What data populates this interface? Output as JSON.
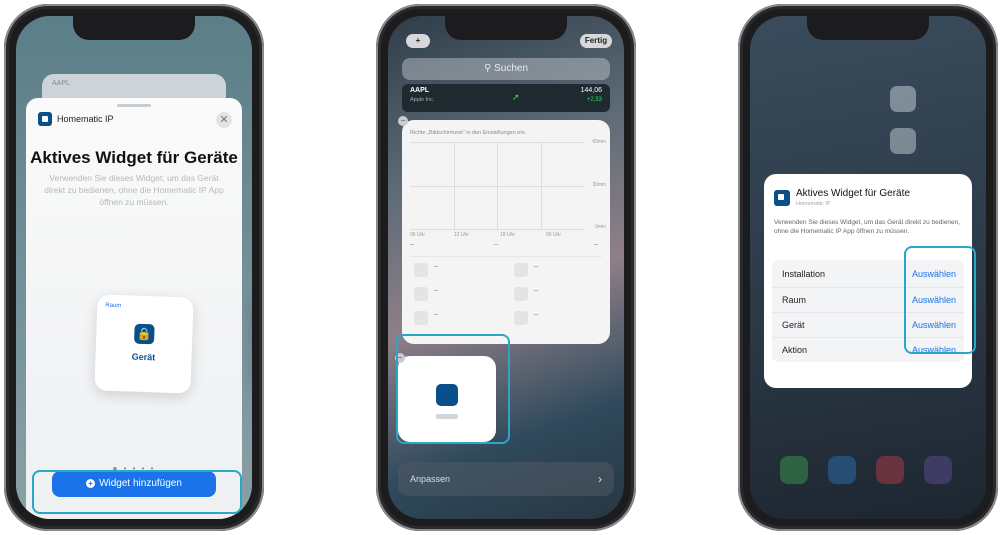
{
  "screen1": {
    "app_name": "Homematic IP",
    "peek_text": "AAPL",
    "close_label": "✕",
    "widget_title": "Aktives Widget für Geräte",
    "widget_description": "Verwenden Sie dieses Widget, um das Gerät direkt zu bedienen, ohne die Homematic IP App öffnen zu müssen.",
    "card_room_label": "Raum",
    "card_device_label": "Gerät",
    "lock_icon": "lock-icon",
    "page_dots": "● • • • •",
    "add_button_label": "Widget hinzufügen",
    "add_icon": "plus-circle-icon"
  },
  "screen2": {
    "plus_label": "+",
    "done_label": "Fertig",
    "search_placeholder": "Suchen",
    "stock_symbol": "AAPL",
    "stock_company": "Apple Inc.",
    "stock_price": "144,06",
    "stock_change": "+2,53",
    "graph_note": "Richte „Bildschirmzeit“ in den Einstellungen ein.",
    "graph_y_labels": [
      "60min",
      "30min",
      "0min"
    ],
    "graph_x_labels": [
      "06 Uhr",
      "12 Uhr",
      "18 Uhr",
      "00 Uhr"
    ],
    "placeholder_dashes": [
      "--",
      "--",
      "--"
    ],
    "list_dashes": [
      "--",
      "--",
      "--",
      "--",
      "--",
      "--"
    ],
    "customize_label": "Anpassen",
    "chevron_label": "›",
    "minus_label": "−"
  },
  "screen3": {
    "dialog_title": "Aktives Widget für Geräte",
    "dialog_subtitle": "Homematic IP",
    "dialog_description": "Verwenden Sie dieses Widget, um das Gerät direkt zu bedienen, ohne die Homematic IP App öffnen zu müssen.",
    "rows": [
      {
        "label": "Installation",
        "action": "Auswählen"
      },
      {
        "label": "Raum",
        "action": "Auswählen"
      },
      {
        "label": "Gerät",
        "action": "Auswählen"
      },
      {
        "label": "Aktion",
        "action": "Auswählen"
      }
    ]
  },
  "colors": {
    "accent_highlight": "#2aa6c6",
    "brand_blue": "#0b4f8a",
    "link_blue": "#1a73e8"
  }
}
